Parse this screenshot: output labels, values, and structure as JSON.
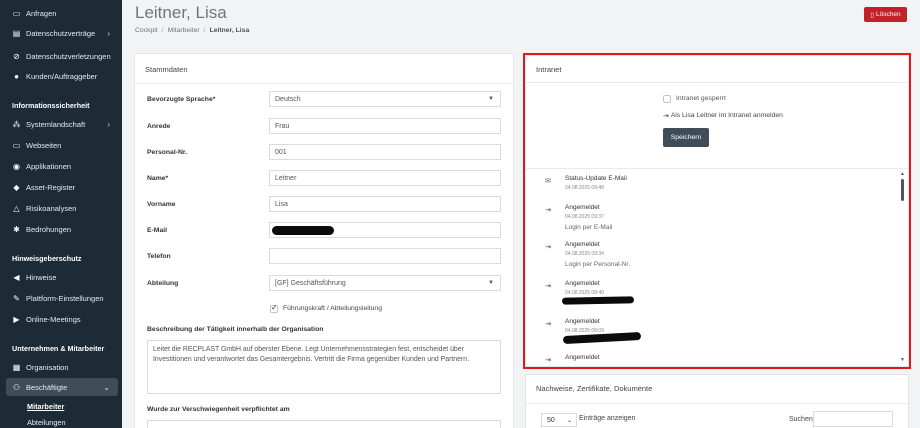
{
  "sidebar": {
    "items_top": [
      {
        "label": "Anfragen",
        "icon": "inbox-icon"
      },
      {
        "label": "Datenschutzverträge",
        "icon": "file-icon",
        "chevron": "›"
      },
      {
        "label": "Datenschutzverletzungen",
        "icon": "alert-icon"
      },
      {
        "label": "Kunden/Auftraggeber",
        "icon": "user-icon"
      }
    ],
    "section_infosec": "Informationssicherheit",
    "items_infosec": [
      {
        "label": "Systemlandschaft",
        "icon": "network-icon",
        "chevron": "›"
      },
      {
        "label": "Webseiten",
        "icon": "monitor-icon"
      },
      {
        "label": "Applikationen",
        "icon": "app-icon"
      },
      {
        "label": "Asset-Register",
        "icon": "diamond-icon"
      },
      {
        "label": "Risikoanalysen",
        "icon": "warning-icon"
      },
      {
        "label": "Bedrohungen",
        "icon": "threat-icon"
      }
    ],
    "section_hints": "Hinweisgeberschutz",
    "items_hints": [
      {
        "label": "Hinweise",
        "icon": "megaphone-icon"
      },
      {
        "label": "Plattform-Einstellungen",
        "icon": "wrench-icon"
      },
      {
        "label": "Online-Meetings",
        "icon": "video-icon"
      }
    ],
    "section_company": "Unternehmen & Mitarbeiter",
    "items_company": [
      {
        "label": "Organisation",
        "icon": "building-icon"
      },
      {
        "label": "Beschäftigte",
        "icon": "users-icon",
        "chevron": "⌄"
      }
    ],
    "sub_items": [
      "Mitarbeiter",
      "Abteilungen"
    ]
  },
  "header": {
    "title": "Leitner, Lisa",
    "breadcrumb": [
      "Cockpit",
      "Mitarbeiter",
      "Leitner, Lisa"
    ],
    "delete_label": "Löschen"
  },
  "stammdaten": {
    "title": "Stammdaten",
    "fields": {
      "language_label": "Bevorzugte Sprache*",
      "language_value": "Deutsch",
      "salutation_label": "Anrede",
      "salutation_value": "Frau",
      "personnel_label": "Personal-Nr.",
      "personnel_value": "001",
      "name_label": "Name*",
      "name_value": "Leitner",
      "firstname_label": "Vorname",
      "firstname_value": "Lisa",
      "email_label": "E-Mail",
      "phone_label": "Telefon",
      "phone_value": "",
      "department_label": "Abteilung",
      "department_value": "[GF] Geschäftsführung",
      "leadership_label": "Führungskraft / Abteilungsleitung",
      "description_label": "Beschreibung der Tätigkeit innerhalb der Organisation",
      "description_value": "Leitet die RECPLAST GmbH auf oberster Ebene. Legt Unternehmensstrategien fest, entscheidet über Investitionen und verantwortet das Gesamtergebnis. Vertritt die Firma gegenüber Kunden und Partnern.",
      "confidentiality_label": "Wurde zur Verschwiegenheit verpflichtet am"
    }
  },
  "intranet": {
    "title": "Intranet",
    "blocked_label": "Intranet gesperrt",
    "login_as_label": "Als Lisa Leitner im Intranet anmelden",
    "save_label": "Speichern",
    "timeline": [
      {
        "icon": "mail-icon",
        "title": "Status-Update E-Mail",
        "date": "04.08.2025 09:48",
        "note": ""
      },
      {
        "icon": "login-icon",
        "title": "Angemeldet",
        "date": "04.08.2025 09:37",
        "note": "Login per E-Mail"
      },
      {
        "icon": "login-icon",
        "title": "Angemeldet",
        "date": "04.08.2025 09:34",
        "note": "Login per Personal-Nr."
      },
      {
        "icon": "login-icon",
        "title": "Angemeldet",
        "date": "04.08.2025 08:40",
        "note": ""
      },
      {
        "icon": "login-icon",
        "title": "Angemeldet",
        "date": "04.08.2025 08:09",
        "note": ""
      },
      {
        "icon": "login-icon",
        "title": "Angemeldet",
        "date": "",
        "note": ""
      }
    ]
  },
  "documents": {
    "title": "Nachweise, Zertifikate, Dokumente",
    "page_size": "50",
    "entries_label": "Einträge anzeigen",
    "search_label": "Suchen"
  }
}
